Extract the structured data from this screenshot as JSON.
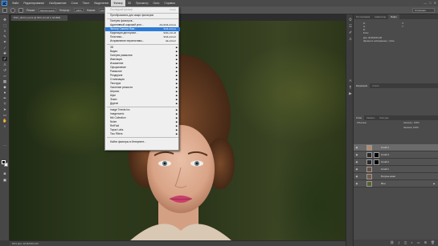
{
  "app": {
    "logo": "Ps",
    "window_controls": [
      "—",
      "□",
      "✕"
    ]
  },
  "menubar": {
    "items": [
      "Файл",
      "Редактирование",
      "Изображение",
      "Слои",
      "Текст",
      "Выделение",
      "Фильтр",
      "3D",
      "Просмотр",
      "Окно",
      "Справка"
    ],
    "active_index": 6
  },
  "options": {
    "size_label": "",
    "mode_label": "Режим:",
    "mode_value": "Нормальный",
    "opacity_label": "Непрозр.:",
    "opacity_value": "100%",
    "flow_label": "Нажим:",
    "flow_value": "100%",
    "workspace": "Основная"
  },
  "document": {
    "tab_title": "DSC_0014 Lycent @ 66% (Слой 4, RGB/8)",
    "status": "66%     Док: 48,9M/203,2M"
  },
  "filter_menu": {
    "top": [
      {
        "label": "Последний фильтр",
        "shortcut": "Ctrl+F",
        "disabled": true
      },
      {
        "label": "Преобразовать для смарт-фильтров",
        "shortcut": "",
        "disabled": false
      }
    ],
    "group1": [
      {
        "label": "Галерея фильтров...",
        "shortcut": ""
      },
      {
        "label": "Адаптивный широкий угол...",
        "shortcut": "Alt+Shift+Ctrl+A"
      },
      {
        "label": "Фильтр Camera Raw...",
        "shortcut": "Shift+Ctrl+A",
        "highlight": true
      },
      {
        "label": "Коррекция дисторсии...",
        "shortcut": "Shift+Ctrl+R"
      },
      {
        "label": "Пластика...",
        "shortcut": "Shift+Ctrl+X"
      },
      {
        "label": "Исправление перспективы...",
        "shortcut": "Alt+Ctrl+V"
      }
    ],
    "submenus": [
      "3D",
      "Видео",
      "Галерея размытия",
      "Имитация",
      "Искажение",
      "Оформление",
      "Размытие",
      "Рендеринг",
      "Стилизация",
      "Текстура",
      "Усиление резкости",
      "Штрихи",
      "Шум",
      "Эскиз",
      "Другие"
    ],
    "plugins": [
      "Image Trends Inc",
      "Imagenomic",
      "Nik Collection",
      "Noise",
      "RetFold",
      "Topaz Labs",
      "Two Filters"
    ],
    "footer": "Найти фильтры в Интернете..."
  },
  "panels": {
    "top_tabs": [
      "Гистограмма",
      "Навигатор",
      "Инфо"
    ],
    "info": [
      "R:",
      "G:",
      "B:",
      "8-бит",
      "X:",
      "Y:",
      "Док: 48,9M/203,2M",
      "Щелкните изображение, чтобы"
    ],
    "mid_tabs": [
      "Коррекция",
      "Стили"
    ],
    "layer_tabs": [
      "Слои",
      "Каналы",
      "Контуры"
    ],
    "blend_mode": "Обычные",
    "opacity": "Непрозр.: 100%",
    "fill": "Заливка: 100%",
    "layers": [
      {
        "name": "Слой 4",
        "selected": true,
        "thumb": "#b58a6a",
        "mask": false
      },
      {
        "name": "Слой 3",
        "selected": false,
        "thumb": "#2a2a2a",
        "mask": true
      },
      {
        "name": "Слой 2",
        "selected": false,
        "thumb": "#2a2a2a",
        "mask": true
      },
      {
        "name": "Слой 1",
        "selected": false,
        "thumb": "#6a5040",
        "mask": false
      },
      {
        "name": "Ретушь кожи",
        "selected": false,
        "thumb": "#7a5a45",
        "mask": false
      },
      {
        "name": "Фон",
        "selected": false,
        "thumb": "#5a6030",
        "mask": false
      }
    ]
  },
  "colors": {
    "menu_highlight": "#2d7cd7",
    "panel_bg": "#4b4b4b",
    "workspace_bg": "#3a3a3a"
  }
}
